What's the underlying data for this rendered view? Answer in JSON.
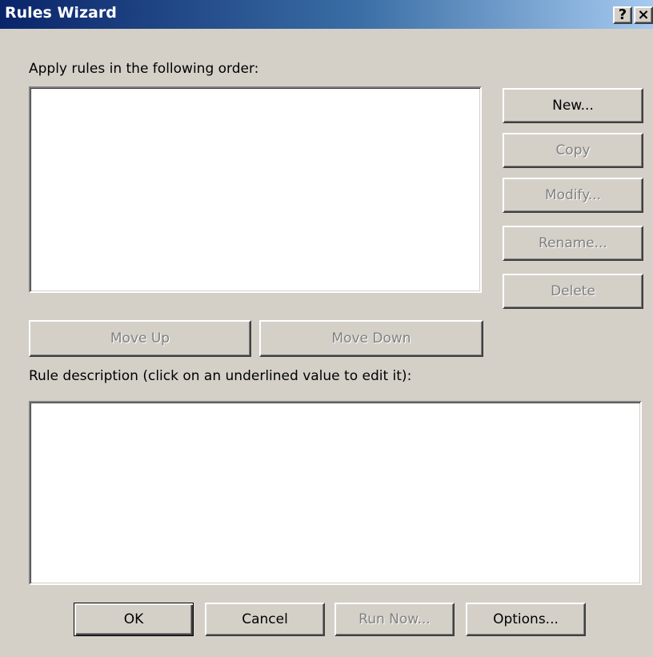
{
  "window": {
    "title": "Rules Wizard",
    "help_glyph": "?",
    "close_glyph": "×"
  },
  "rules": {
    "label": "Apply rules in the following order:",
    "items": []
  },
  "side_buttons": {
    "new": "New...",
    "copy": "Copy",
    "modify": "Modify...",
    "rename": "Rename...",
    "delete": "Delete"
  },
  "move_buttons": {
    "up": "Move Up",
    "down": "Move Down"
  },
  "description": {
    "label": "Rule description (click on an underlined value to edit it):",
    "text": ""
  },
  "bottom_buttons": {
    "ok": "OK",
    "cancel": "Cancel",
    "run_now": "Run Now...",
    "options": "Options..."
  },
  "colors": {
    "face": "#d4d0c8",
    "title_start": "#0a246a",
    "title_end": "#a6caf0",
    "disabled_text": "#808080"
  }
}
